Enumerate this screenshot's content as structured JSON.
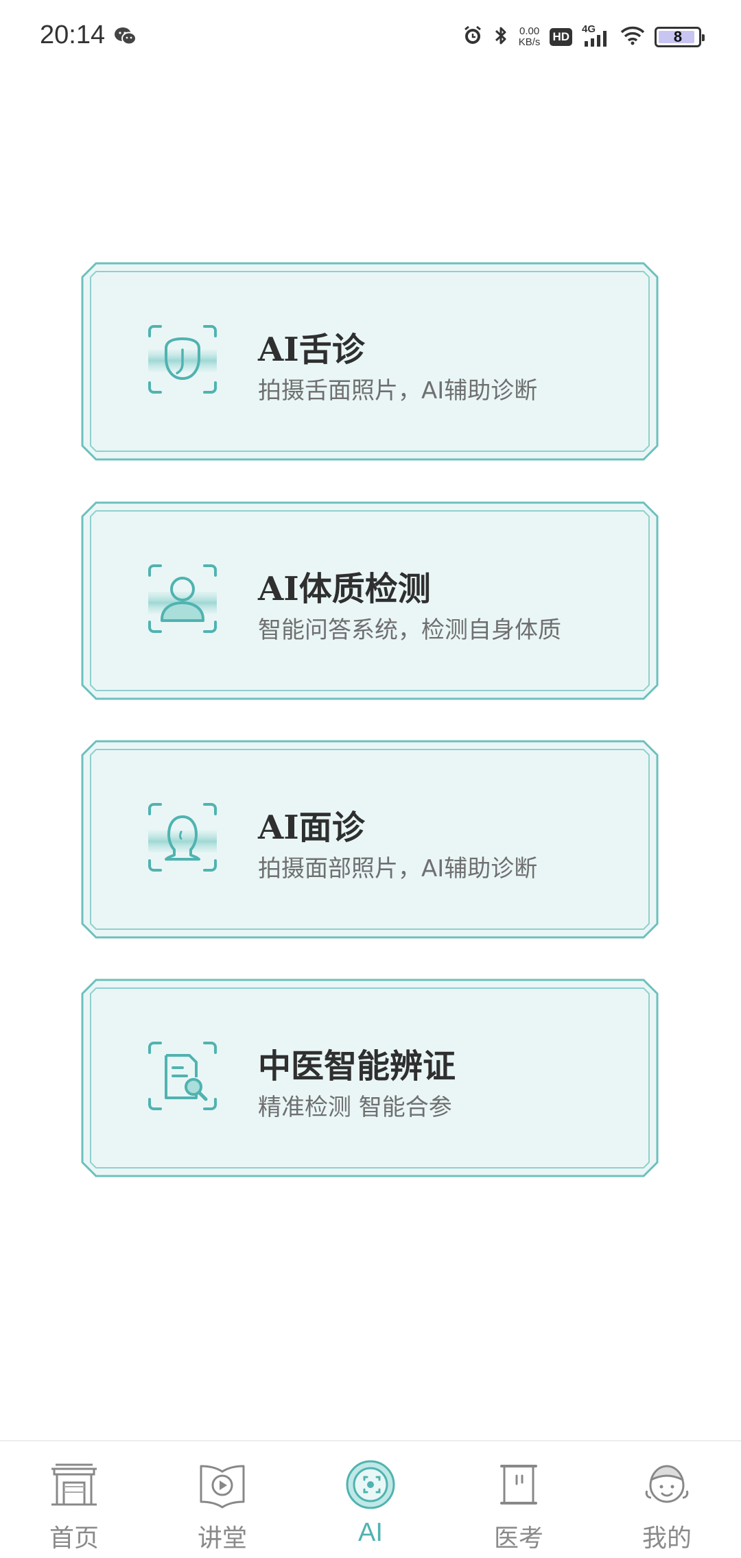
{
  "status_bar": {
    "time": "20:14",
    "net_speed_value": "0.00",
    "net_speed_unit": "KB/s",
    "hd": "HD",
    "network": "4G",
    "battery": "8"
  },
  "cards": [
    {
      "title": "AI舌诊",
      "subtitle": "拍摄舌面照片，AI辅助诊断",
      "icon": "tongue-scan-icon"
    },
    {
      "title": "AI体质检测",
      "subtitle": "智能问答系统，检测自身体质",
      "icon": "person-scan-icon"
    },
    {
      "title": "AI面诊",
      "subtitle": "拍摄面部照片，AI辅助诊断",
      "icon": "face-scan-icon"
    },
    {
      "title": "中医智能辨证",
      "subtitle": "精准检测 智能合参",
      "icon": "document-search-icon"
    }
  ],
  "bottom_nav": [
    {
      "label": "首页",
      "icon": "home-gate-icon",
      "active": false
    },
    {
      "label": "讲堂",
      "icon": "video-book-icon",
      "active": false
    },
    {
      "label": "AI",
      "icon": "ai-orb-icon",
      "active": true
    },
    {
      "label": "医考",
      "icon": "scroll-icon",
      "active": false
    },
    {
      "label": "我的",
      "icon": "doctor-avatar-icon",
      "active": false
    }
  ],
  "colors": {
    "accent": "#4fb3b0",
    "card_fill": "#eaf6f6",
    "card_border": "#6cc0bd"
  }
}
